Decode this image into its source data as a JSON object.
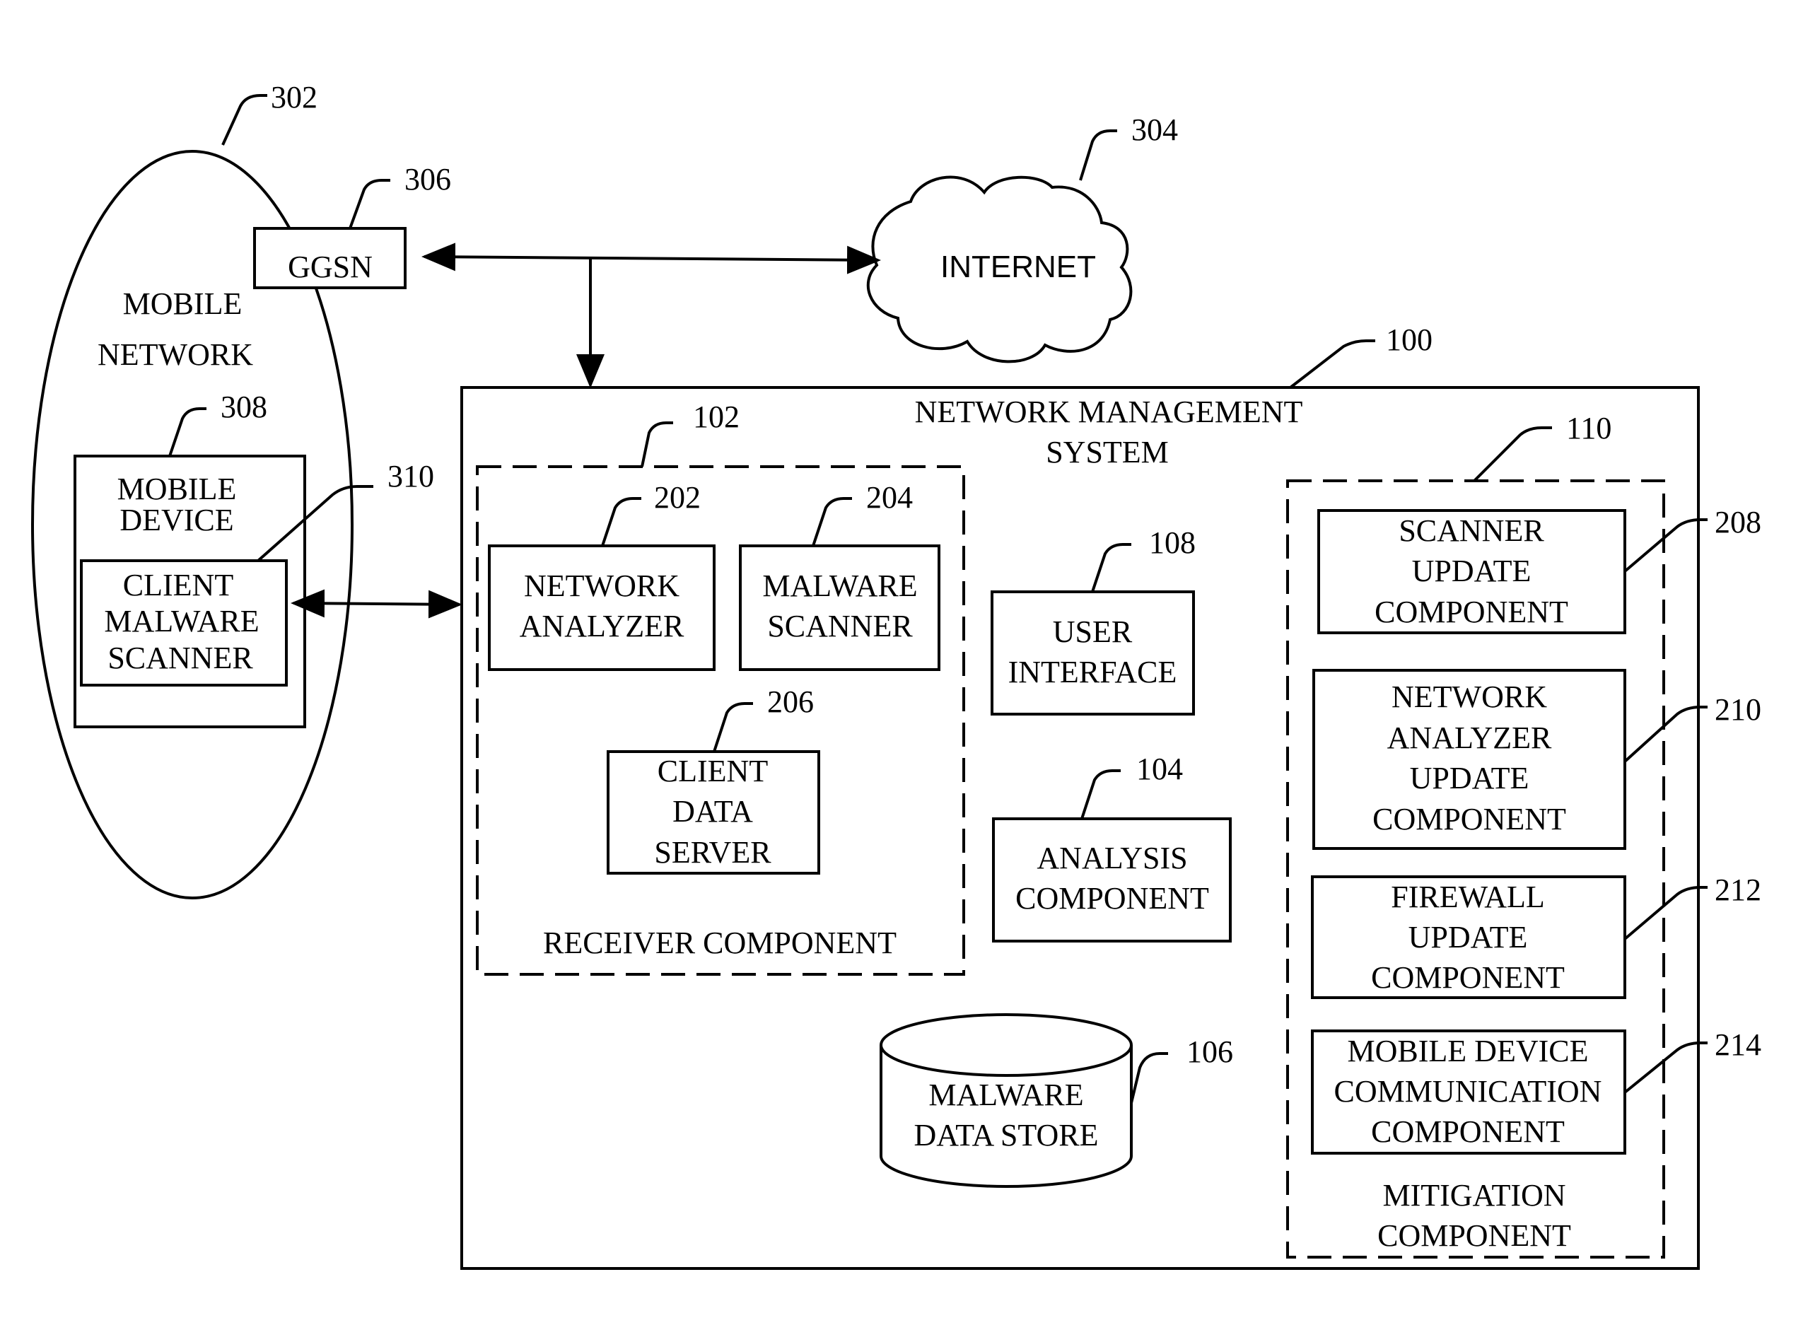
{
  "mobile_network": {
    "ref": "302",
    "label_lines": [
      "MOBILE",
      "NETWORK"
    ]
  },
  "ggsn": {
    "ref": "306",
    "label": "GGSN"
  },
  "internet": {
    "ref": "304",
    "label": "INTERNET"
  },
  "mobile_device": {
    "ref": "308",
    "label_lines": [
      "MOBILE",
      "DEVICE"
    ]
  },
  "client_malware_scanner": {
    "ref": "310",
    "label_lines": [
      "CLIENT",
      "MALWARE",
      "SCANNER"
    ]
  },
  "network_management_system": {
    "ref": "100",
    "label_lines": [
      "NETWORK MANAGEMENT",
      "SYSTEM"
    ]
  },
  "receiver_component": {
    "ref": "102",
    "label": "RECEIVER COMPONENT"
  },
  "network_analyzer": {
    "ref": "202",
    "label_lines": [
      "NETWORK",
      "ANALYZER"
    ]
  },
  "malware_scanner": {
    "ref": "204",
    "label_lines": [
      "MALWARE",
      "SCANNER"
    ]
  },
  "client_data_server": {
    "ref": "206",
    "label_lines": [
      "CLIENT",
      "DATA",
      "SERVER"
    ]
  },
  "user_interface": {
    "ref": "108",
    "label_lines": [
      "USER",
      "INTERFACE"
    ]
  },
  "analysis_component": {
    "ref": "104",
    "label_lines": [
      "ANALYSIS",
      "COMPONENT"
    ]
  },
  "malware_data_store": {
    "ref": "106",
    "label_lines": [
      "MALWARE",
      "DATA STORE"
    ]
  },
  "mitigation_component": {
    "ref": "110",
    "label_lines": [
      "MITIGATION",
      "COMPONENT"
    ]
  },
  "scanner_update": {
    "ref": "208",
    "label_lines": [
      "SCANNER",
      "UPDATE",
      "COMPONENT"
    ]
  },
  "network_analyzer_update": {
    "ref": "210",
    "label_lines": [
      "NETWORK",
      "ANALYZER",
      "UPDATE",
      "COMPONENT"
    ]
  },
  "firewall_update": {
    "ref": "212",
    "label_lines": [
      "FIREWALL",
      "UPDATE",
      "COMPONENT"
    ]
  },
  "mobile_device_comm": {
    "ref": "214",
    "label_lines": [
      "MOBILE DEVICE",
      "COMMUNICATION",
      "COMPONENT"
    ]
  }
}
